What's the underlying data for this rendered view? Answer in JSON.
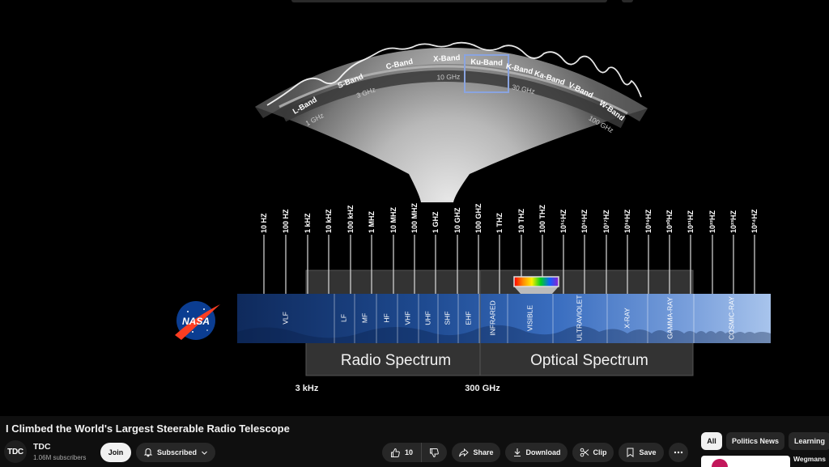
{
  "video": {
    "title": "I Climbed the World's Largest Steerable Radio Telescope",
    "spectrum_figure": {
      "bands": [
        "L-Band",
        "S-Band",
        "C-Band",
        "X-Band",
        "Ku-Band",
        "K-Band",
        "Ka-Band",
        "V-Band",
        "W-Band"
      ],
      "arc_freqs": [
        "1 GHz",
        "3 GHz",
        "10 GHz",
        "30 GHz",
        "100 GHz"
      ],
      "tick_freqs": [
        "10 HZ",
        "100 HZ",
        "1 kHZ",
        "10 kHZ",
        "100 kHZ",
        "1 MHZ",
        "10 MHZ",
        "100 MHZ",
        "1 GHZ",
        "10 GHZ",
        "100 GHZ",
        "1 THZ",
        "10 THZ",
        "100 THZ",
        "10¹⁵HZ",
        "10¹⁶HZ",
        "10¹⁷HZ",
        "10¹⁸HZ",
        "10¹⁹HZ",
        "10²⁰HZ",
        "10²¹HZ",
        "10²²HZ",
        "10²³HZ",
        "10²⁴HZ"
      ],
      "segments": [
        "VLF",
        "LF",
        "MF",
        "HF",
        "VHF",
        "UHF",
        "SHF",
        "EHF",
        "INFRARED",
        "VISIBLE",
        "ULTRAVIOLET",
        "X-RAY",
        "GAMMA-RAY",
        "COSMIC-RAY"
      ],
      "radio_label": "Radio Spectrum",
      "optical_label": "Optical Spectrum",
      "left_bound": "3 kHz",
      "right_bound": "300 GHz",
      "logo_text": "NASA"
    }
  },
  "channel": {
    "avatar_text": "TDC",
    "name": "TDC",
    "subscribers": "1.06M subscribers"
  },
  "actions": {
    "join": "Join",
    "subscribed": "Subscribed",
    "like_count": "10",
    "share": "Share",
    "download": "Download",
    "clip": "Clip",
    "save": "Save"
  },
  "chips": [
    "All",
    "Politics News",
    "Learning"
  ],
  "recommendation": {
    "title": "Wegmans"
  },
  "colors": {
    "accent": "#f1f1f1",
    "background": "#0f0f0f",
    "spectrum_blue": "#3a5fa8"
  }
}
